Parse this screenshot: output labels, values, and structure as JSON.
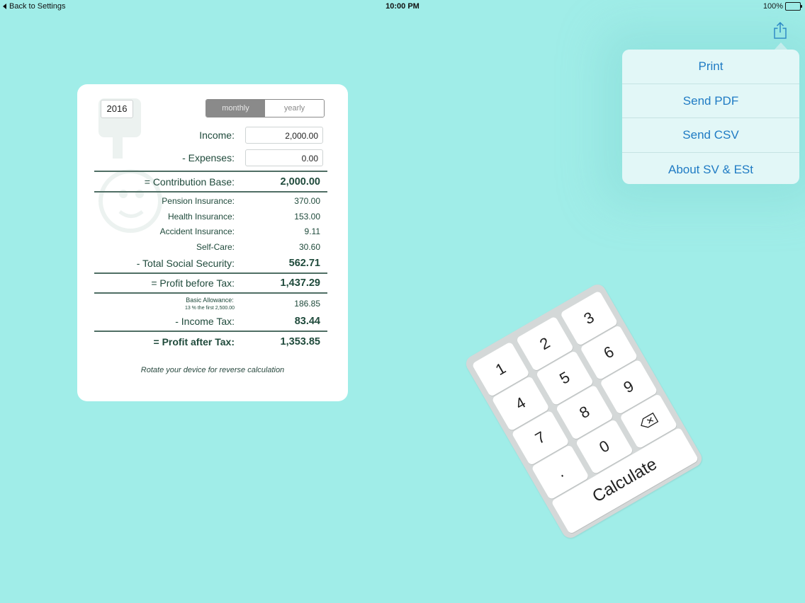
{
  "status_bar": {
    "back_label": "Back to Settings",
    "time": "10:00 PM",
    "battery": "100%"
  },
  "share_menu": {
    "items": [
      "Print",
      "Send PDF",
      "Send CSV",
      "About SV & ESt"
    ]
  },
  "calculator": {
    "year": "2016",
    "period_options": [
      "monthly",
      "yearly"
    ],
    "selected_period": "monthly",
    "income_label": "Income:",
    "income_value": "2,000.00",
    "expenses_label": "- Expenses:",
    "expenses_value": "0.00",
    "contribution_base_label": "= Contribution Base:",
    "contribution_base_value": "2,000.00",
    "pension_label": "Pension Insurance:",
    "pension_value": "370.00",
    "health_label": "Health Insurance:",
    "health_value": "153.00",
    "accident_label": "Accident Insurance:",
    "accident_value": "9.11",
    "selfcare_label": "Self-Care:",
    "selfcare_value": "30.60",
    "total_ss_label": "- Total Social Security:",
    "total_ss_value": "562.71",
    "profit_before_label": "= Profit before Tax:",
    "profit_before_value": "1,437.29",
    "allowance_label": "Basic Allowance:",
    "allowance_sub": "13 % the first 2,500.00",
    "allowance_value": "186.85",
    "income_tax_label": "- Income Tax:",
    "income_tax_value": "83.44",
    "profit_after_label": "= Profit after Tax:",
    "profit_after_value": "1,353.85",
    "rotate_note": "Rotate your device for reverse calculation"
  },
  "keypad": {
    "keys": [
      "1",
      "2",
      "3",
      "4",
      "5",
      "6",
      "7",
      "8",
      "9",
      ".",
      "0"
    ],
    "calculate_label": "Calculate"
  },
  "colors": {
    "background": "#a0ede8",
    "accent_blue": "#1f7bc4",
    "text_green": "#1f4a3b"
  }
}
